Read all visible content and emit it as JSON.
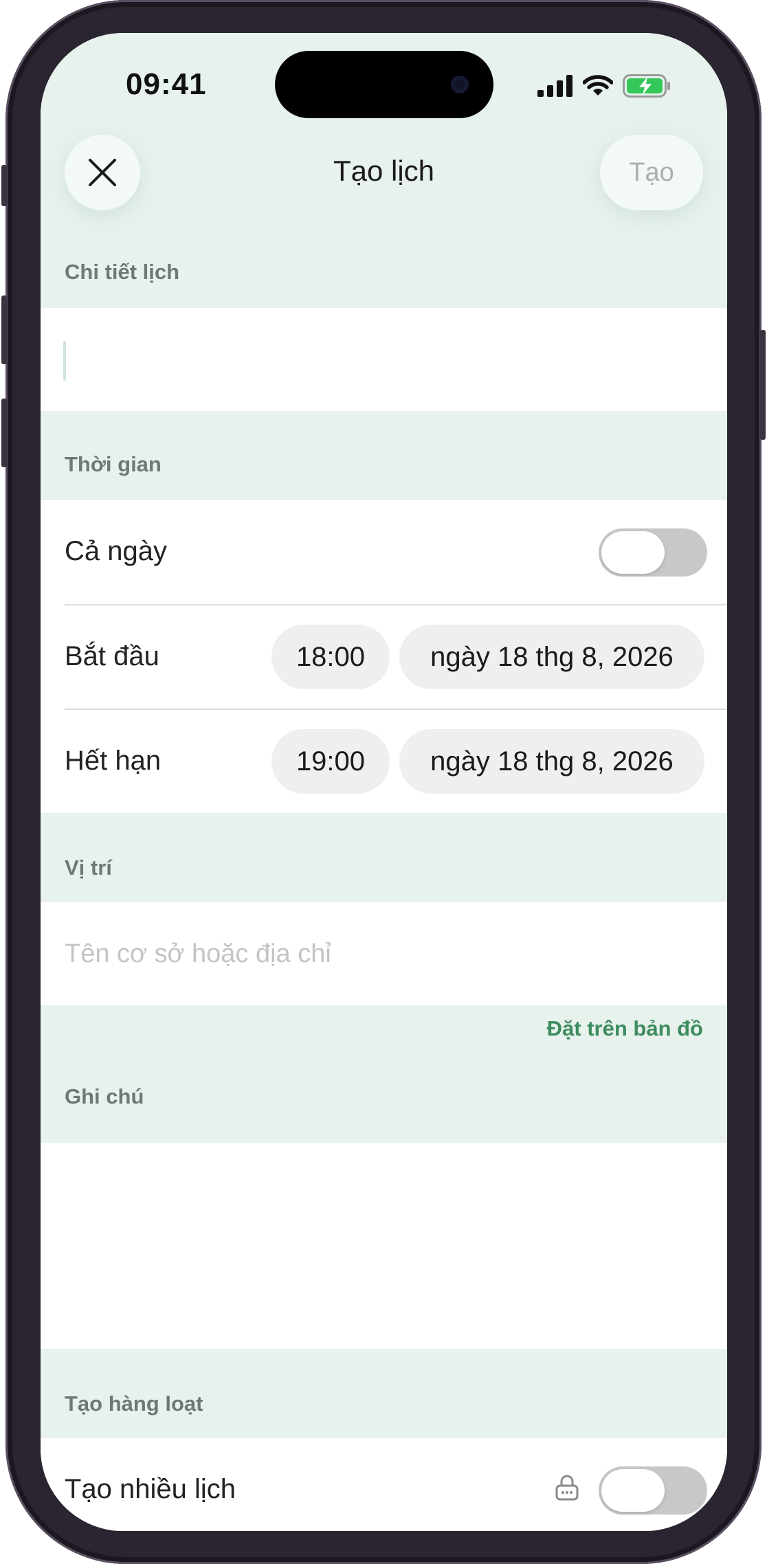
{
  "status_bar": {
    "time": "09:41"
  },
  "header": {
    "title": "Tạo lịch",
    "close_icon": "close-icon",
    "create_label": "Tạo"
  },
  "details": {
    "section_label": "Chi tiết lịch",
    "title_value": ""
  },
  "time_section": {
    "section_label": "Thời gian",
    "all_day_label": "Cả ngày",
    "all_day_on": false,
    "start_label": "Bắt đầu",
    "start_time": "18:00",
    "start_date": "ngày 18 thg 8, 2026",
    "end_label": "Hết hạn",
    "end_time": "19:00",
    "end_date": "ngày 18 thg 8, 2026"
  },
  "location": {
    "section_label": "Vị trí",
    "placeholder": "Tên cơ sở hoặc địa chỉ",
    "map_link": "Đặt trên bản đồ"
  },
  "notes": {
    "section_label": "Ghi chú",
    "value": ""
  },
  "batch": {
    "section_label": "Tạo hàng loạt",
    "multi_label": "Tạo nhiều lịch",
    "multi_on": false,
    "lock_icon": "lock-icon"
  },
  "colors": {
    "section_bg": "#e8f2ed",
    "accent": "#3d8c5f",
    "battery": "#34c759"
  }
}
